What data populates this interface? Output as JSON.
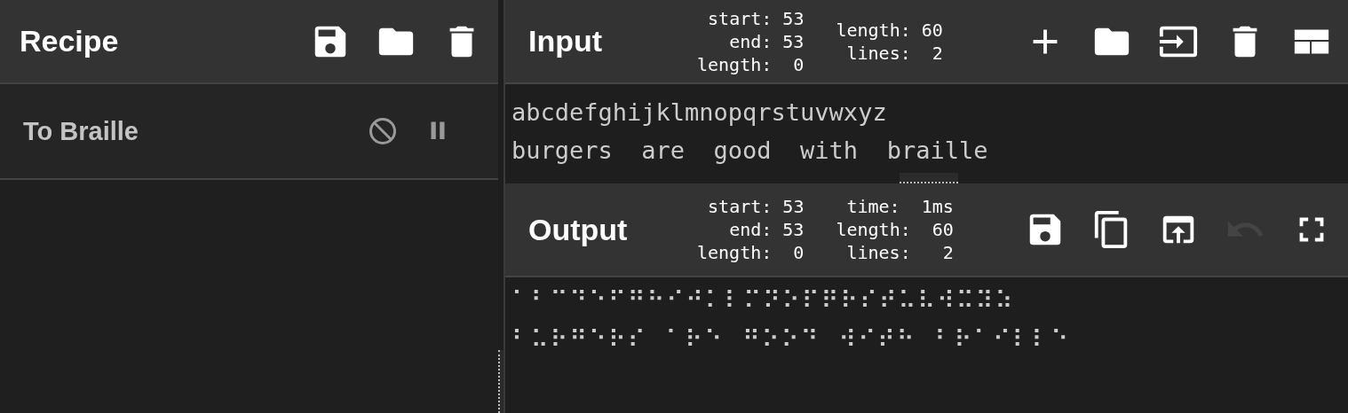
{
  "recipe": {
    "title": "Recipe",
    "buttons": [
      {
        "kind": "save",
        "disabled": false
      },
      {
        "kind": "folder",
        "disabled": false
      },
      {
        "kind": "trash",
        "disabled": false
      }
    ],
    "operations": [
      {
        "name": "To Braille",
        "disabled": false,
        "breakpoint": false
      }
    ]
  },
  "input": {
    "title": "Input",
    "stats": [
      [
        "start: 53",
        "end: 53",
        "length:  0"
      ],
      [
        "length: 60",
        "lines:  2"
      ]
    ],
    "buttons": [
      {
        "kind": "plus",
        "disabled": false
      },
      {
        "kind": "folder",
        "disabled": false
      },
      {
        "kind": "import",
        "disabled": false
      },
      {
        "kind": "trash",
        "disabled": false
      },
      {
        "kind": "layout",
        "disabled": false
      }
    ],
    "lines": [
      "abcdefghijklmnopqrstuvwxyz",
      "burgers  are  good  with  braille"
    ]
  },
  "output": {
    "title": "Output",
    "stats": [
      [
        "start: 53",
        "end: 53",
        "length:  0"
      ],
      [
        "time:  1ms",
        "length:  60",
        "lines:   2"
      ]
    ],
    "buttons": [
      {
        "kind": "save",
        "disabled": false
      },
      {
        "kind": "copy",
        "disabled": false
      },
      {
        "kind": "export",
        "disabled": false
      },
      {
        "kind": "undo",
        "disabled": true
      },
      {
        "kind": "fullscreen",
        "disabled": false
      }
    ],
    "lines": [
      "⠁⠃⠉⠙⠑⠋⠛⠓⠊⠚⠅⠇⠍⠝⠕⠏⠟⠗⠎⠞⠥⠧⠺⠭⠽⠵",
      "⠃⠥⠗⠛⠑⠗⠎  ⠁⠗⠑  ⠛⠕⠕⠙  ⠺⠊⠞⠓  ⠃⠗⠁⠊⠇⠇⠑"
    ]
  }
}
